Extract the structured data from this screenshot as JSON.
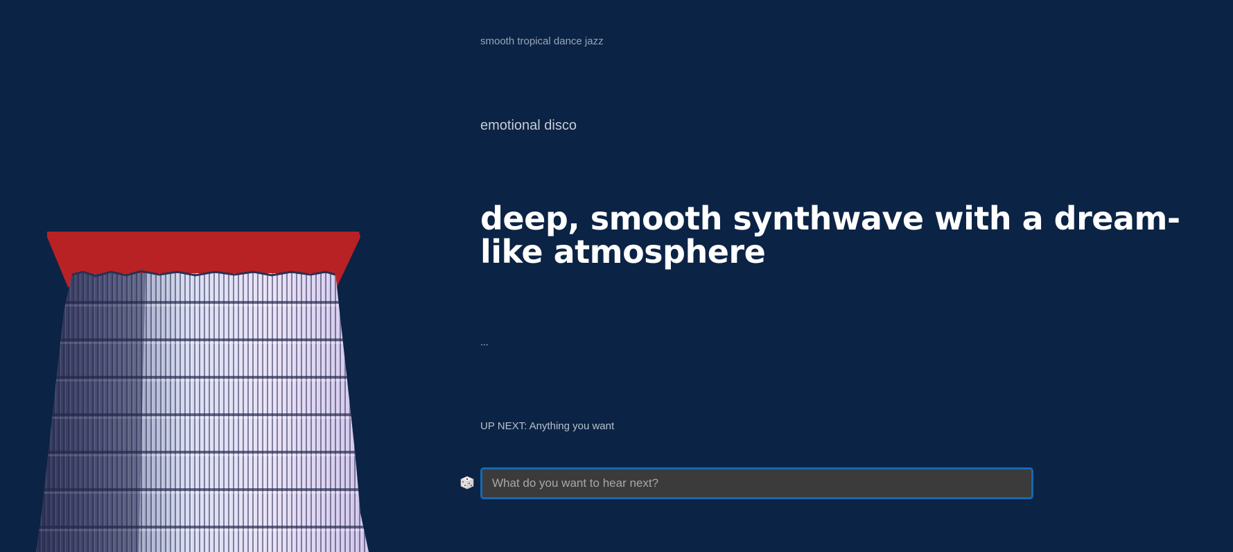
{
  "colors": {
    "background": "#0b2345",
    "visualizer_top": "#b82225",
    "input_border": "#1669b3",
    "input_background": "#3b3b3b"
  },
  "history": {
    "older_prompt": "smooth tropical dance jazz",
    "previous_prompt": "emotional disco",
    "current_prompt": "deep, smooth synthwave with a dream-like atmosphere",
    "status": "..."
  },
  "up_next": {
    "text": "UP NEXT: Anything you want"
  },
  "input": {
    "placeholder": "What do you want to hear next?",
    "value": ""
  },
  "icons": {
    "dice": "dice-icon"
  }
}
